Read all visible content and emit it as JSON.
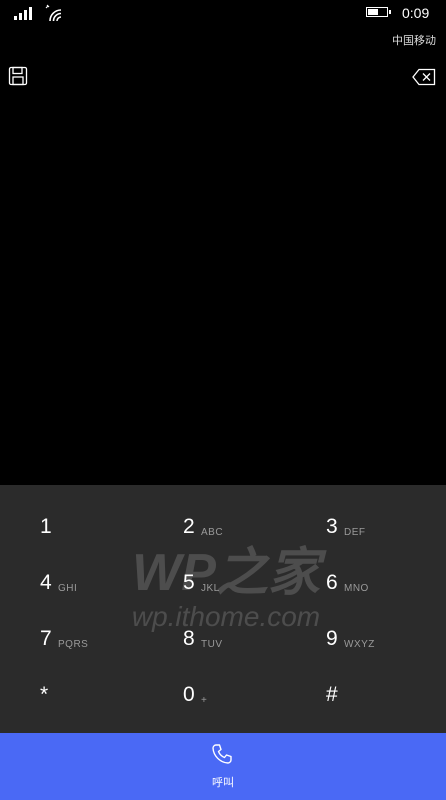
{
  "status_bar": {
    "time": "0:09",
    "carrier": "中国移动",
    "battery_level": 0.55
  },
  "dialer": {
    "number": "",
    "keys": [
      {
        "digit": "1",
        "letters": ""
      },
      {
        "digit": "2",
        "letters": "ABC"
      },
      {
        "digit": "3",
        "letters": "DEF"
      },
      {
        "digit": "4",
        "letters": "GHI"
      },
      {
        "digit": "5",
        "letters": "JKL"
      },
      {
        "digit": "6",
        "letters": "MNO"
      },
      {
        "digit": "7",
        "letters": "PQRS"
      },
      {
        "digit": "8",
        "letters": "TUV"
      },
      {
        "digit": "9",
        "letters": "WXYZ"
      },
      {
        "digit": "*",
        "letters": ""
      },
      {
        "digit": "0",
        "letters": "+"
      },
      {
        "digit": "#",
        "letters": ""
      }
    ],
    "call_label": "呼叫"
  },
  "watermark": {
    "brand": "WP之家",
    "url": "wp.ithome.com"
  },
  "colors": {
    "background": "#000000",
    "keypad": "#2b2b2b",
    "call_bar": "#4a69f5",
    "key_letters": "#9a9a9a"
  },
  "icons": {
    "save": "floppy-disk-icon",
    "backspace": "backspace-icon",
    "call": "phone-icon",
    "signal": "signal-strength-icon",
    "wifi": "wifi-icon",
    "battery": "battery-icon"
  }
}
